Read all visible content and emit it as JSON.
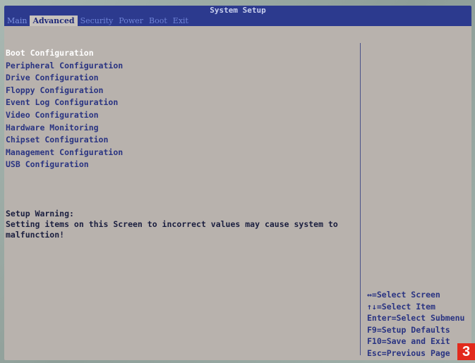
{
  "window": {
    "title": "System Setup"
  },
  "menu": {
    "tabs": [
      "Main",
      "Advanced",
      "Security",
      "Power",
      "Boot",
      "Exit"
    ],
    "active_index": 1
  },
  "advanced": {
    "items": [
      "Boot Configuration",
      "Peripheral Configuration",
      "Drive Configuration",
      "Floppy Configuration",
      "Event Log Configuration",
      "Video Configuration",
      "Hardware Monitoring",
      "Chipset Configuration",
      "Management Configuration",
      "USB Configuration"
    ],
    "selected_index": 0
  },
  "warning": {
    "title": "Setup Warning:",
    "line1": "Setting items on this Screen to incorrect values may cause system to",
    "line2": "malfunction!"
  },
  "help": {
    "lines": [
      "↔=Select Screen",
      "↑↓=Select Item",
      "Enter=Select Submenu",
      "F9=Setup Defaults",
      "F10=Save and Exit",
      "Esc=Previous Page"
    ]
  },
  "badge": {
    "text": "3"
  },
  "colors": {
    "bar_bg": "#2c3a8e",
    "screen_bg": "#b8b2ad",
    "text_blue": "#2a3482",
    "badge_red": "#e22a1c"
  }
}
